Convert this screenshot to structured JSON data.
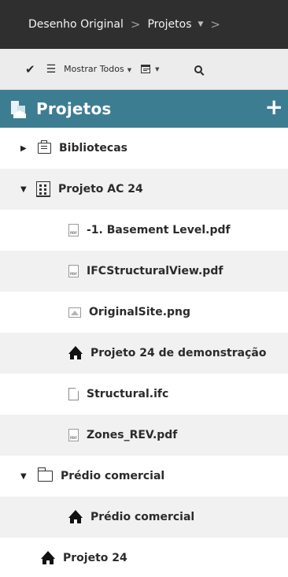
{
  "breadcrumb": {
    "items": [
      "Desenho Original",
      "Projetos"
    ],
    "separator": ">"
  },
  "toolbar": {
    "filter_label": "Mostrar Todos"
  },
  "panel": {
    "title": "Projetos",
    "add_label": "+"
  },
  "tree": [
    {
      "label": "Bibliotecas",
      "icon": "library-icon",
      "arrow": "collapsed"
    },
    {
      "label": "Projeto AC 24",
      "icon": "project-icon",
      "arrow": "expanded"
    },
    {
      "label": "-1. Basement Level.pdf",
      "icon": "pdf-icon"
    },
    {
      "label": "IFCStructuralView.pdf",
      "icon": "pdf-icon"
    },
    {
      "label": "OriginalSite.png",
      "icon": "image-icon"
    },
    {
      "label": "Projeto 24 de demonstração",
      "icon": "house-icon"
    },
    {
      "label": "Structural.ifc",
      "icon": "file-icon"
    },
    {
      "label": "Zones_REV.pdf",
      "icon": "pdf-icon"
    },
    {
      "label": "Prédio comercial",
      "icon": "folder-icon",
      "arrow": "expanded"
    },
    {
      "label": "Prédio comercial",
      "icon": "house-icon"
    },
    {
      "label": "Projeto 24",
      "icon": "house-icon"
    }
  ],
  "colors": {
    "breadcrumb_bg": "#2f2f2f",
    "toolbar_bg": "#ececec",
    "header_bg": "#3d7d92",
    "alt_row_bg": "#f1f1f1"
  }
}
